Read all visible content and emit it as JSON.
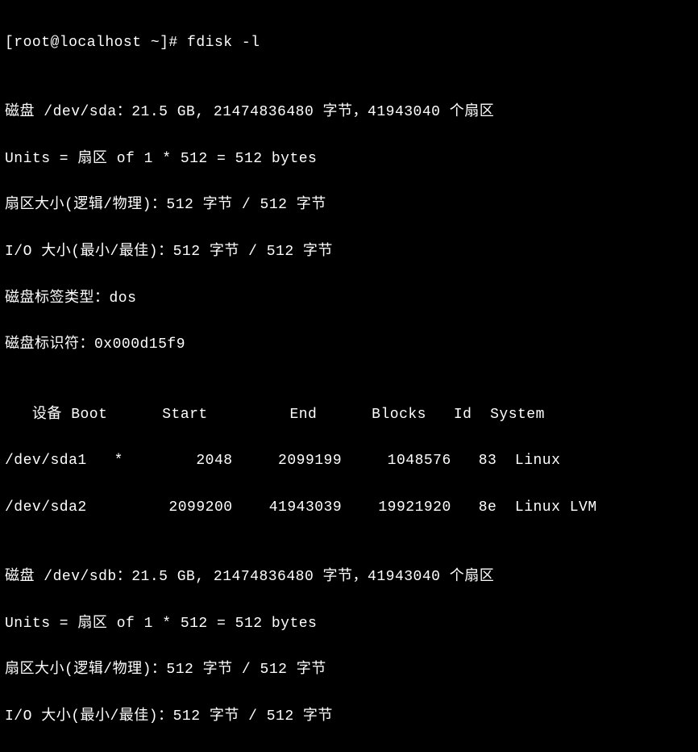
{
  "prompt": "[root@localhost ~]# fdisk -l",
  "blank1": "",
  "disk_sda": {
    "header": "磁盘 /dev/sda：21.5 GB, 21474836480 字节，41943040 个扇区",
    "units": "Units = 扇区 of 1 * 512 = 512 bytes",
    "sector_size": "扇区大小(逻辑/物理)：512 字节 / 512 字节",
    "io_size": "I/O 大小(最小/最佳)：512 字节 / 512 字节",
    "label_type": "磁盘标签类型：dos",
    "identifier": "磁盘标识符：0x000d15f9"
  },
  "blank2": "",
  "partition_table": {
    "header": "   设备 Boot      Start         End      Blocks   Id  System",
    "row1": "/dev/sda1   *        2048     2099199     1048576   83  Linux",
    "row2": "/dev/sda2         2099200    41943039    19921920   8e  Linux LVM"
  },
  "blank3": "",
  "disk_sdb": {
    "header": "磁盘 /dev/sdb：21.5 GB, 21474836480 字节，41943040 个扇区",
    "units": "Units = 扇区 of 1 * 512 = 512 bytes",
    "sector_size": "扇区大小(逻辑/物理)：512 字节 / 512 字节",
    "io_size": "I/O 大小(最小/最佳)：512 字节 / 512 字节"
  }
}
